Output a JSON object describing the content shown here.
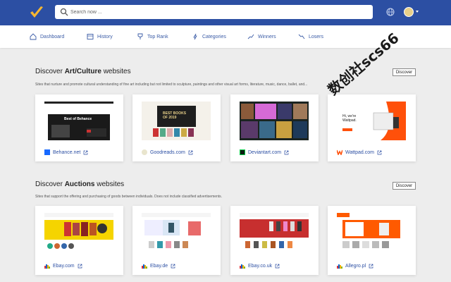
{
  "search": {
    "placeholder": "Search now ..."
  },
  "nav": [
    {
      "label": "Dashboard"
    },
    {
      "label": "History"
    },
    {
      "label": "Top Rank"
    },
    {
      "label": "Categories"
    },
    {
      "label": "Winners"
    },
    {
      "label": "Losers"
    }
  ],
  "sections": [
    {
      "prefix": "Discover ",
      "bold": "Art/Culture",
      "suffix": " websites",
      "description": "Sites that nurture and promote cultural understanding of fine art including but not limited to sculpture, paintings and other visual art forms, literature, music, dance, ballet, and...",
      "button": "Discover",
      "cards": [
        {
          "name": "Behance.net",
          "thumb_title": "Best of Behance"
        },
        {
          "name": "Goodreads.com",
          "thumb_title": "BEST BOOKS OF 2019"
        },
        {
          "name": "Deviantart.com"
        },
        {
          "name": "Wattpad.com",
          "thumb_title": "Hi, we're Wattpad."
        }
      ]
    },
    {
      "prefix": "Discover ",
      "bold": "Auctions",
      "suffix": " websites",
      "description": "Sites that support the offering and purchasing of goods between individuals. Does not include classified advertisements.",
      "button": "Discover",
      "cards": [
        {
          "name": "Ebay.com"
        },
        {
          "name": "Ebay.de"
        },
        {
          "name": "Ebay.co.uk"
        },
        {
          "name": "Allegro.pl"
        }
      ]
    }
  ],
  "watermark": "数创社scs66",
  "colors": {
    "brand": "#2c4fa3",
    "background": "#ededed",
    "check": "#f7b731"
  }
}
